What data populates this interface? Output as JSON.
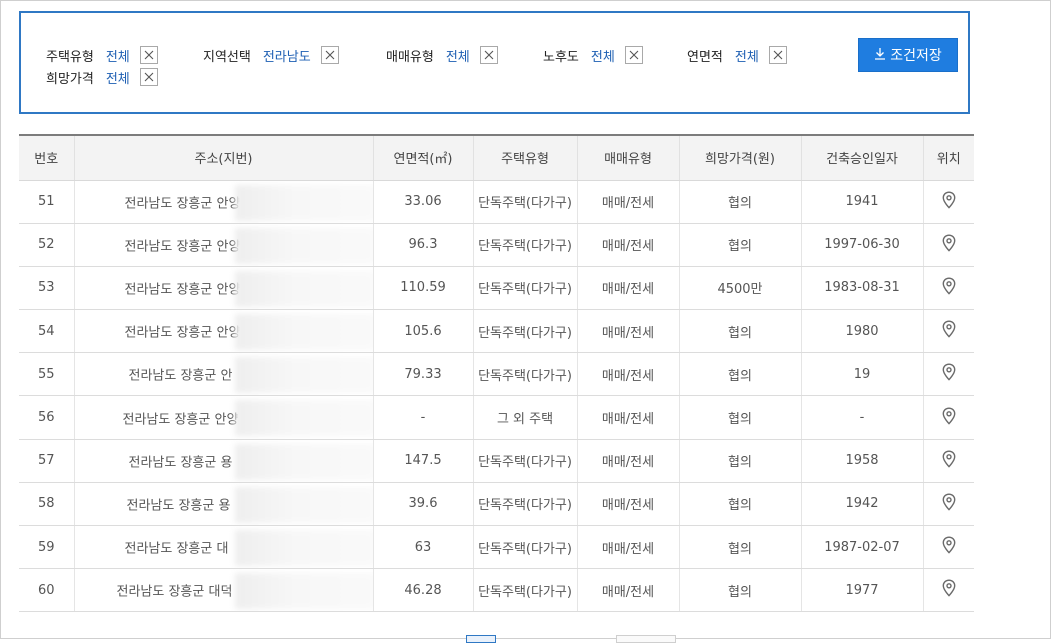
{
  "filters": [
    {
      "label": "주택유형",
      "value": "전체"
    },
    {
      "label": "지역선택",
      "value": "전라남도"
    },
    {
      "label": "매매유형",
      "value": "전체"
    },
    {
      "label": "노후도",
      "value": "전체"
    },
    {
      "label": "연면적",
      "value": "전체"
    },
    {
      "label": "희망가격",
      "value": "전체"
    }
  ],
  "save_button": "조건저장",
  "table": {
    "headers": [
      "번호",
      "주소(지번)",
      "연면적(㎡)",
      "주택유형",
      "매매유형",
      "희망가격(원)",
      "건축승인일자",
      "위치"
    ],
    "rows": [
      {
        "no": "51",
        "addr": "전라남도 장흥군 안양",
        "area": "33.06",
        "type": "단독주택(다가구)",
        "trade": "매매/전세",
        "price": "협의",
        "date": "1941"
      },
      {
        "no": "52",
        "addr": "전라남도 장흥군 안양",
        "area": "96.3",
        "type": "단독주택(다가구)",
        "trade": "매매/전세",
        "price": "협의",
        "date": "1997-06-30"
      },
      {
        "no": "53",
        "addr": "전라남도 장흥군 안양",
        "area": "110.59",
        "type": "단독주택(다가구)",
        "trade": "매매/전세",
        "price": "4500만",
        "date": "1983-08-31"
      },
      {
        "no": "54",
        "addr": "전라남도 장흥군 안양",
        "area": "105.6",
        "type": "단독주택(다가구)",
        "trade": "매매/전세",
        "price": "협의",
        "date": "1980"
      },
      {
        "no": "55",
        "addr": "전라남도 장흥군 안",
        "area": "79.33",
        "type": "단독주택(다가구)",
        "trade": "매매/전세",
        "price": "협의",
        "date": "19"
      },
      {
        "no": "56",
        "addr": "전라남도 장흥군 안양",
        "area": "-",
        "type": "그 외 주택",
        "trade": "매매/전세",
        "price": "협의",
        "date": "-"
      },
      {
        "no": "57",
        "addr": "전라남도 장흥군 용",
        "area": "147.5",
        "type": "단독주택(다가구)",
        "trade": "매매/전세",
        "price": "협의",
        "date": "1958"
      },
      {
        "no": "58",
        "addr": "전라남도 장흥군 용",
        "area": "39.6",
        "type": "단독주택(다가구)",
        "trade": "매매/전세",
        "price": "협의",
        "date": "1942"
      },
      {
        "no": "59",
        "addr": "전라남도 장흥군 대",
        "area": "63",
        "type": "단독주택(다가구)",
        "trade": "매매/전세",
        "price": "협의",
        "date": "1987-02-07"
      },
      {
        "no": "60",
        "addr": "전라남도 장흥군 대덕",
        "area": "46.28",
        "type": "단독주택(다가구)",
        "trade": "매매/전세",
        "price": "협의",
        "date": "1977"
      }
    ]
  },
  "icons": {
    "close": "close-icon",
    "download": "download-icon",
    "location": "location-pin-icon"
  },
  "colors": {
    "accent": "#2f78c4",
    "value_text": "#1e5fb3",
    "button_bg": "#1f7de0"
  }
}
